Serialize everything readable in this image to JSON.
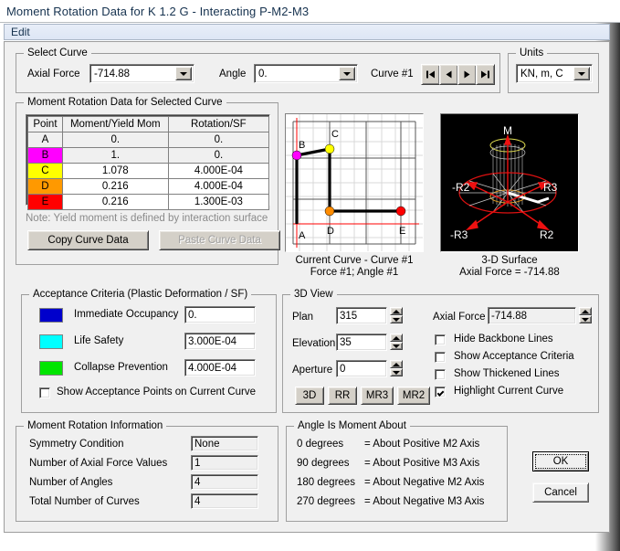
{
  "window": {
    "title": "Moment Rotation Data for K 1.2 G - Interacting P-M2-M3",
    "menu": [
      "Edit"
    ]
  },
  "select_curve": {
    "title": "Select Curve",
    "axial_force_label": "Axial Force",
    "axial_force_value": "-714.88",
    "angle_label": "Angle",
    "angle_value": "0.",
    "curve_label": "Curve #1",
    "nav": [
      "first-record-icon",
      "previous-record-icon",
      "next-record-icon",
      "last-record-icon"
    ]
  },
  "units": {
    "title": "Units",
    "value": "KN, m, C"
  },
  "moment_rotation_data": {
    "title": "Moment Rotation Data for Selected Curve",
    "columns": [
      "Point",
      "Moment/Yield Mom",
      "Rotation/SF"
    ],
    "rows": [
      {
        "point": "A",
        "moment": "0.",
        "rotation": "0.",
        "color": "#f0f0f0",
        "editable": false
      },
      {
        "point": "B",
        "moment": "1.",
        "rotation": "0.",
        "color": "#ff00ff",
        "editable": false
      },
      {
        "point": "C",
        "moment": "1.078",
        "rotation": "4.000E-04",
        "color": "#ffff00",
        "editable": true
      },
      {
        "point": "D",
        "moment": "0.216",
        "rotation": "4.000E-04",
        "color": "#ff9900",
        "editable": true
      },
      {
        "point": "E",
        "moment": "0.216",
        "rotation": "1.300E-03",
        "color": "#ff0000",
        "editable": true
      }
    ],
    "note": "Note:  Yield moment is defined by interaction surface",
    "copy_button": "Copy Curve Data",
    "paste_button": "Paste Curve Data"
  },
  "curve_plot": {
    "caption_line1": "Current Curve - Curve #1",
    "caption_line2": "Force #1;  Angle #1",
    "point_labels": [
      "A",
      "B",
      "C",
      "D",
      "E"
    ]
  },
  "surface_plot": {
    "caption_line1": "3-D Surface",
    "caption_line2": "Axial Force = -714.88",
    "axis_labels": [
      "M",
      "R3",
      "R2",
      "-R2",
      "-R3"
    ]
  },
  "acceptance_criteria": {
    "title": "Acceptance Criteria (Plastic Deformation / SF)",
    "items": [
      {
        "label": "Immediate Occupancy",
        "color": "#0000cc",
        "value": "0."
      },
      {
        "label": "Life Safety",
        "color": "#00ffff",
        "value": "3.000E-04"
      },
      {
        "label": "Collapse Prevention",
        "color": "#00e500",
        "value": "4.000E-04"
      }
    ],
    "show_points_label": "Show Acceptance Points on Current Curve",
    "show_points_checked": false
  },
  "view_3d": {
    "title": "3D View",
    "plan_label": "Plan",
    "plan_value": "315",
    "elevation_label": "Elevation",
    "elevation_value": "35",
    "aperture_label": "Aperture",
    "aperture_value": "0",
    "axial_force_label": "Axial Force",
    "axial_force_value": "-714.88",
    "view_buttons": [
      "3D",
      "RR",
      "MR3",
      "MR2"
    ],
    "checkboxes": [
      {
        "label": "Hide Backbone Lines",
        "checked": false
      },
      {
        "label": "Show Acceptance Criteria",
        "checked": false
      },
      {
        "label": "Show Thickened Lines",
        "checked": false
      },
      {
        "label": "Highlight Current Curve",
        "checked": true
      }
    ]
  },
  "moment_rotation_info": {
    "title": "Moment Rotation Information",
    "rows": [
      {
        "label": "Symmetry Condition",
        "value": "None"
      },
      {
        "label": "Number of Axial Force Values",
        "value": "1"
      },
      {
        "label": "Number of Angles",
        "value": "4"
      },
      {
        "label": "Total Number of Curves",
        "value": "4"
      }
    ]
  },
  "angle_is_moment_about": {
    "title": "Angle Is Moment About",
    "rows": [
      {
        "deg": "0 degrees",
        "desc": "=  About Positive M2 Axis"
      },
      {
        "deg": "90 degrees",
        "desc": "=  About Positive M3 Axis"
      },
      {
        "deg": "180 degrees",
        "desc": "=  About Negative M2 Axis"
      },
      {
        "deg": "270 degrees",
        "desc": "=  About Negative M3 Axis"
      }
    ]
  },
  "actions": {
    "ok": "OK",
    "cancel": "Cancel"
  }
}
